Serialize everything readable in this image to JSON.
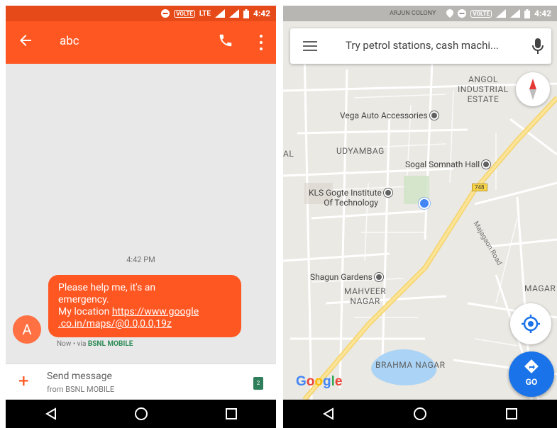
{
  "left_phone": {
    "status": {
      "volte": "VOLTE",
      "lte": "LTE",
      "time": "4:42"
    },
    "appbar": {
      "title": "abc"
    },
    "conversation": {
      "timestamp": "4:42 PM",
      "avatar_letter": "A",
      "message": {
        "line1": "Please help me, it's an",
        "line2": "emergency.",
        "location_label": "My location ",
        "link_part1": "https://www.google",
        "link_part2": ".co.in/maps/@0.0,0.0,19z"
      },
      "meta_prefix": "Now • via ",
      "meta_carrier": "BSNL MOBILE"
    },
    "composer": {
      "placeholder": "Send message",
      "sub": "from BSNL MOBILE"
    }
  },
  "right_phone": {
    "status": {
      "volte": "VOLTE",
      "time": "4:42",
      "top_area": "ARJUN COLONY"
    },
    "search": {
      "placeholder": "Try petrol stations, cash machi..."
    },
    "map": {
      "places": [
        {
          "name": "Vega Auto Accessories"
        },
        {
          "name": "Sogal Somnath Hall"
        },
        {
          "name": "KLS Gogte Institute",
          "name2": "Of Technology"
        },
        {
          "name": "Shagun Gardens"
        }
      ],
      "areas": [
        {
          "line1": "ANGOL",
          "line2": "INDUSTRIAL",
          "line3": "ESTATE"
        },
        {
          "line1": "UDYAMBAG"
        },
        {
          "line1": "MAHVEER",
          "line2": "NAGAR"
        },
        {
          "line1": "BRAHMA NAGAR"
        },
        {
          "line1": "MAGAR"
        },
        {
          "line1": "AL"
        }
      ],
      "highway_shield": "748",
      "road_label": "Majagaon Road",
      "logo": [
        "G",
        "o",
        "o",
        "g",
        "l",
        "e"
      ]
    },
    "fab": {
      "go_label": "GO"
    }
  }
}
